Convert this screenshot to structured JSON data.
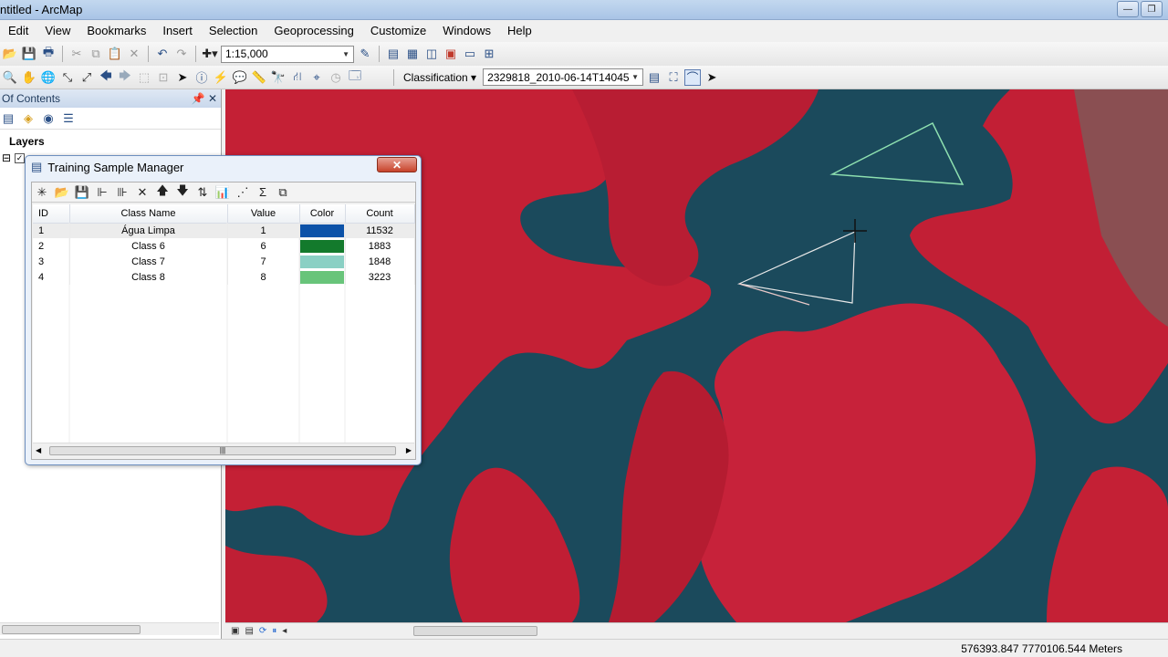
{
  "window": {
    "title": "ntitled - ArcMap"
  },
  "menu": [
    "Edit",
    "View",
    "Bookmarks",
    "Insert",
    "Selection",
    "Geoprocessing",
    "Customize",
    "Windows",
    "Help"
  ],
  "toolbar": {
    "scale": "1:15,000",
    "classification_label": "Classification",
    "layer_combo": "2329818_2010-06-14T14045"
  },
  "toc": {
    "title": "Of Contents",
    "layers_label": "Layers"
  },
  "training_sample_manager": {
    "title": "Training Sample Manager",
    "close_label": "✕",
    "columns": [
      "ID",
      "Class Name",
      "Value",
      "Color",
      "Count"
    ],
    "rows": [
      {
        "id": "1",
        "name": "Água Limpa",
        "value": "1",
        "color": "#0c52a8",
        "count": "11532"
      },
      {
        "id": "2",
        "name": "Class 6",
        "value": "6",
        "color": "#137a2c",
        "count": "1883"
      },
      {
        "id": "3",
        "name": "Class 7",
        "value": "7",
        "color": "#8ad0c4",
        "count": "1848"
      },
      {
        "id": "4",
        "name": "Class 8",
        "value": "8",
        "color": "#68c47a",
        "count": "3223"
      }
    ]
  },
  "status": {
    "coordinates": "576393.847  7770106.544 Meters"
  }
}
